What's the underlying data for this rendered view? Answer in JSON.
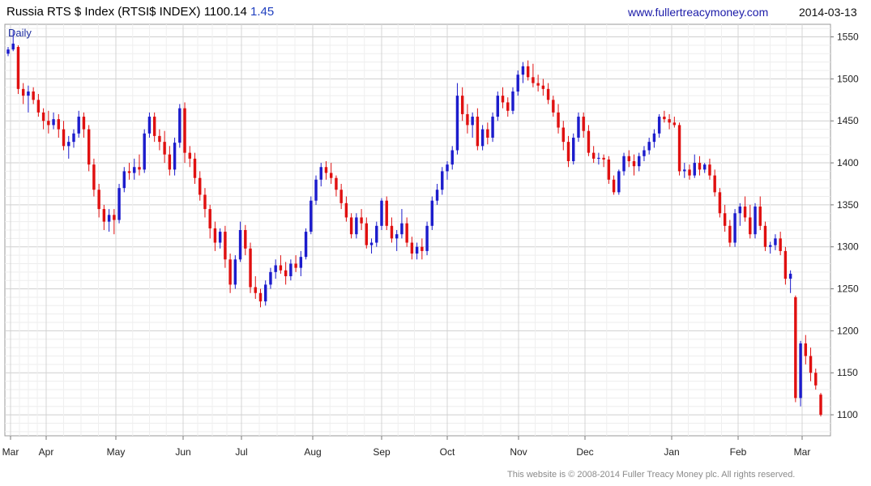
{
  "header": {
    "title": "Russia RTS $ Index (RTSI$ INDEX) 1100.14",
    "change": "1.45",
    "website": "www.fullertreacymoney.com",
    "date": "2014-03-13"
  },
  "footer": "This website is © 2008-2014 Fuller Treacy Money plc. All rights reserved.",
  "chart_data": {
    "type": "candlestick",
    "period_label": "Daily",
    "x_tick_labels": [
      "Mar",
      "Apr",
      "May",
      "Jun",
      "Jul",
      "Aug",
      "Sep",
      "Oct",
      "Nov",
      "Dec",
      "Jan",
      "Feb",
      "Mar"
    ],
    "y_ticks": [
      1100,
      1150,
      1200,
      1250,
      1300,
      1350,
      1400,
      1450,
      1500,
      1550
    ],
    "ylim": [
      1075,
      1565
    ],
    "grid": true,
    "colors": {
      "up": "#1c1ccc",
      "down": "#e01010",
      "grid": "#d8d8d8",
      "frame": "#999999"
    },
    "series": [
      {
        "values": [
          [
            1530,
            1538,
            1527,
            1535
          ],
          [
            1535,
            1557,
            1533,
            1542
          ],
          [
            1538,
            1540,
            1482,
            1488
          ],
          [
            1488,
            1495,
            1470,
            1480
          ],
          [
            1480,
            1492,
            1460,
            1485
          ],
          [
            1485,
            1490,
            1470,
            1475
          ],
          [
            1475,
            1482,
            1455,
            1460
          ],
          [
            1460,
            1465,
            1440,
            1450
          ],
          [
            1450,
            1462,
            1435,
            1445
          ],
          [
            1445,
            1460,
            1440,
            1452
          ],
          [
            1452,
            1458,
            1430,
            1440
          ],
          [
            1440,
            1450,
            1415,
            1420
          ],
          [
            1420,
            1432,
            1405,
            1425
          ],
          [
            1425,
            1440,
            1418,
            1435
          ],
          [
            1435,
            1462,
            1430,
            1455
          ],
          [
            1455,
            1460,
            1430,
            1440
          ],
          [
            1440,
            1445,
            1390,
            1398
          ],
          [
            1398,
            1405,
            1360,
            1368
          ],
          [
            1368,
            1375,
            1335,
            1345
          ],
          [
            1345,
            1350,
            1320,
            1330
          ],
          [
            1330,
            1345,
            1318,
            1338
          ],
          [
            1338,
            1345,
            1315,
            1332
          ],
          [
            1332,
            1375,
            1328,
            1370
          ],
          [
            1370,
            1395,
            1365,
            1390
          ],
          [
            1390,
            1400,
            1380,
            1388
          ],
          [
            1388,
            1405,
            1380,
            1395
          ],
          [
            1395,
            1410,
            1385,
            1392
          ],
          [
            1392,
            1440,
            1388,
            1435
          ],
          [
            1435,
            1460,
            1430,
            1455
          ],
          [
            1455,
            1460,
            1425,
            1432
          ],
          [
            1432,
            1440,
            1415,
            1425
          ],
          [
            1425,
            1438,
            1400,
            1410
          ],
          [
            1410,
            1420,
            1385,
            1392
          ],
          [
            1392,
            1430,
            1385,
            1424
          ],
          [
            1424,
            1470,
            1418,
            1465
          ],
          [
            1465,
            1472,
            1400,
            1412
          ],
          [
            1412,
            1420,
            1395,
            1405
          ],
          [
            1405,
            1412,
            1375,
            1382
          ],
          [
            1382,
            1390,
            1355,
            1362
          ],
          [
            1362,
            1370,
            1335,
            1345
          ],
          [
            1345,
            1350,
            1310,
            1322
          ],
          [
            1322,
            1330,
            1295,
            1305
          ],
          [
            1305,
            1322,
            1298,
            1318
          ],
          [
            1318,
            1325,
            1275,
            1285
          ],
          [
            1285,
            1292,
            1245,
            1255
          ],
          [
            1255,
            1290,
            1250,
            1285
          ],
          [
            1285,
            1330,
            1282,
            1320
          ],
          [
            1320,
            1326,
            1290,
            1298
          ],
          [
            1298,
            1305,
            1245,
            1252
          ],
          [
            1252,
            1265,
            1238,
            1245
          ],
          [
            1245,
            1250,
            1228,
            1235
          ],
          [
            1235,
            1260,
            1230,
            1255
          ],
          [
            1255,
            1275,
            1250,
            1270
          ],
          [
            1270,
            1285,
            1262,
            1278
          ],
          [
            1278,
            1290,
            1268,
            1272
          ],
          [
            1272,
            1282,
            1255,
            1265
          ],
          [
            1265,
            1285,
            1260,
            1280
          ],
          [
            1280,
            1290,
            1270,
            1275
          ],
          [
            1275,
            1295,
            1265,
            1288
          ],
          [
            1288,
            1322,
            1285,
            1318
          ],
          [
            1318,
            1360,
            1315,
            1355
          ],
          [
            1355,
            1385,
            1350,
            1380
          ],
          [
            1380,
            1400,
            1372,
            1395
          ],
          [
            1395,
            1402,
            1380,
            1388
          ],
          [
            1388,
            1400,
            1375,
            1382
          ],
          [
            1382,
            1385,
            1360,
            1368
          ],
          [
            1368,
            1375,
            1345,
            1352
          ],
          [
            1352,
            1360,
            1330,
            1335
          ],
          [
            1335,
            1340,
            1310,
            1315
          ],
          [
            1315,
            1340,
            1310,
            1335
          ],
          [
            1335,
            1345,
            1320,
            1328
          ],
          [
            1328,
            1335,
            1298,
            1302
          ],
          [
            1302,
            1310,
            1292,
            1305
          ],
          [
            1305,
            1330,
            1300,
            1325
          ],
          [
            1325,
            1358,
            1320,
            1355
          ],
          [
            1355,
            1360,
            1320,
            1325
          ],
          [
            1325,
            1335,
            1305,
            1310
          ],
          [
            1310,
            1320,
            1295,
            1315
          ],
          [
            1315,
            1345,
            1310,
            1328
          ],
          [
            1328,
            1335,
            1300,
            1305
          ],
          [
            1305,
            1312,
            1285,
            1292
          ],
          [
            1292,
            1305,
            1285,
            1300
          ],
          [
            1300,
            1310,
            1285,
            1295
          ],
          [
            1295,
            1330,
            1290,
            1325
          ],
          [
            1325,
            1360,
            1320,
            1355
          ],
          [
            1355,
            1375,
            1350,
            1368
          ],
          [
            1368,
            1395,
            1362,
            1390
          ],
          [
            1390,
            1402,
            1380,
            1398
          ],
          [
            1398,
            1420,
            1392,
            1415
          ],
          [
            1415,
            1495,
            1410,
            1480
          ],
          [
            1480,
            1490,
            1450,
            1458
          ],
          [
            1458,
            1470,
            1435,
            1445
          ],
          [
            1445,
            1460,
            1430,
            1455
          ],
          [
            1455,
            1465,
            1415,
            1420
          ],
          [
            1420,
            1445,
            1415,
            1440
          ],
          [
            1440,
            1448,
            1422,
            1430
          ],
          [
            1430,
            1460,
            1425,
            1455
          ],
          [
            1455,
            1485,
            1450,
            1480
          ],
          [
            1480,
            1490,
            1465,
            1472
          ],
          [
            1472,
            1478,
            1455,
            1462
          ],
          [
            1462,
            1490,
            1458,
            1485
          ],
          [
            1485,
            1510,
            1480,
            1505
          ],
          [
            1505,
            1520,
            1495,
            1515
          ],
          [
            1515,
            1522,
            1498,
            1502
          ],
          [
            1502,
            1518,
            1490,
            1495
          ],
          [
            1495,
            1505,
            1485,
            1492
          ],
          [
            1492,
            1500,
            1480,
            1488
          ],
          [
            1488,
            1495,
            1470,
            1475
          ],
          [
            1475,
            1480,
            1455,
            1460
          ],
          [
            1460,
            1470,
            1435,
            1442
          ],
          [
            1442,
            1450,
            1415,
            1425
          ],
          [
            1425,
            1432,
            1395,
            1402
          ],
          [
            1402,
            1435,
            1398,
            1430
          ],
          [
            1430,
            1460,
            1425,
            1455
          ],
          [
            1455,
            1460,
            1430,
            1438
          ],
          [
            1438,
            1445,
            1408,
            1412
          ],
          [
            1412,
            1420,
            1400,
            1405
          ],
          [
            1405,
            1412,
            1398,
            1406
          ],
          [
            1406,
            1410,
            1395,
            1404
          ],
          [
            1404,
            1408,
            1375,
            1380
          ],
          [
            1380,
            1385,
            1362,
            1365
          ],
          [
            1365,
            1392,
            1362,
            1390
          ],
          [
            1390,
            1412,
            1385,
            1408
          ],
          [
            1408,
            1415,
            1395,
            1402
          ],
          [
            1402,
            1410,
            1385,
            1396
          ],
          [
            1396,
            1412,
            1390,
            1408
          ],
          [
            1408,
            1420,
            1402,
            1415
          ],
          [
            1415,
            1430,
            1410,
            1425
          ],
          [
            1425,
            1440,
            1418,
            1435
          ],
          [
            1435,
            1458,
            1430,
            1455
          ],
          [
            1455,
            1462,
            1448,
            1452
          ],
          [
            1452,
            1458,
            1440,
            1448
          ],
          [
            1448,
            1455,
            1442,
            1445
          ],
          [
            1445,
            1448,
            1385,
            1390
          ],
          [
            1390,
            1400,
            1382,
            1392
          ],
          [
            1392,
            1398,
            1380,
            1385
          ],
          [
            1385,
            1410,
            1382,
            1400
          ],
          [
            1400,
            1408,
            1385,
            1392
          ],
          [
            1392,
            1400,
            1388,
            1398
          ],
          [
            1398,
            1405,
            1380,
            1385
          ],
          [
            1385,
            1392,
            1360,
            1365
          ],
          [
            1365,
            1370,
            1335,
            1340
          ],
          [
            1340,
            1350,
            1318,
            1325
          ],
          [
            1325,
            1332,
            1300,
            1305
          ],
          [
            1305,
            1345,
            1300,
            1340
          ],
          [
            1340,
            1352,
            1325,
            1348
          ],
          [
            1348,
            1360,
            1330,
            1335
          ],
          [
            1335,
            1350,
            1310,
            1315
          ],
          [
            1315,
            1352,
            1310,
            1348
          ],
          [
            1348,
            1360,
            1320,
            1325
          ],
          [
            1325,
            1330,
            1295,
            1300
          ],
          [
            1300,
            1306,
            1292,
            1302
          ],
          [
            1302,
            1315,
            1296,
            1310
          ],
          [
            1310,
            1318,
            1290,
            1295
          ],
          [
            1295,
            1300,
            1255,
            1262
          ],
          [
            1262,
            1272,
            1245,
            1268
          ],
          [
            1240,
            1242,
            1115,
            1120
          ],
          [
            1120,
            1188,
            1110,
            1185
          ],
          [
            1185,
            1195,
            1160,
            1170
          ],
          [
            1170,
            1180,
            1140,
            1150
          ],
          [
            1150,
            1155,
            1130,
            1135
          ],
          [
            1124,
            1126,
            1098,
            1100
          ]
        ]
      }
    ]
  }
}
